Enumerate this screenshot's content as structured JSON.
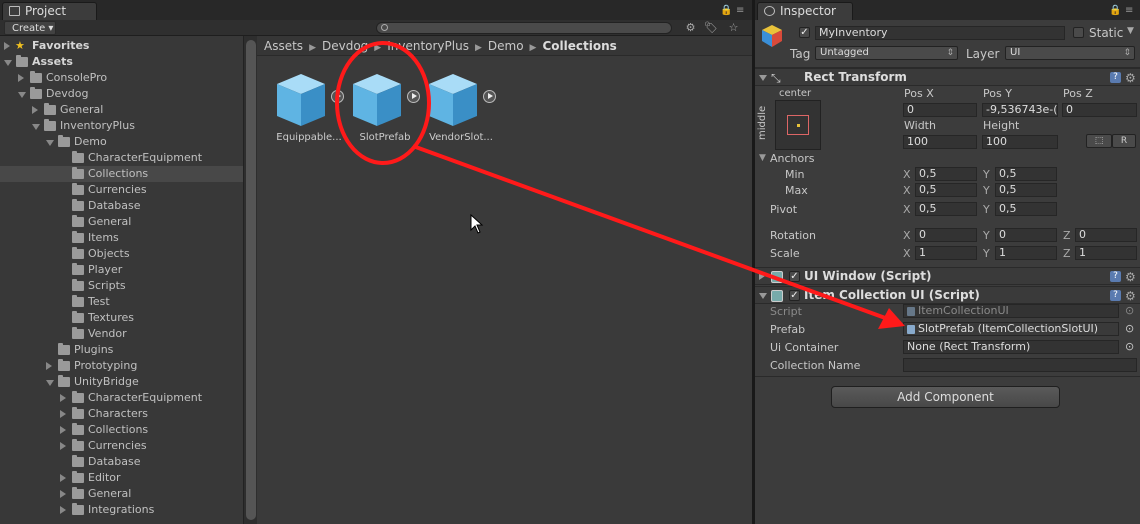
{
  "project": {
    "tab_label": "Project",
    "create_label": "Create",
    "search_placeholder": "",
    "tree": [
      {
        "label": "Favorites",
        "indent": 0,
        "arrow": "closed",
        "bold": true,
        "icon": "star"
      },
      {
        "label": "Assets",
        "indent": 0,
        "arrow": "open",
        "bold": true,
        "icon": "folder"
      },
      {
        "label": "ConsolePro",
        "indent": 1,
        "arrow": "closed",
        "icon": "folder"
      },
      {
        "label": "Devdog",
        "indent": 1,
        "arrow": "open",
        "icon": "folder"
      },
      {
        "label": "General",
        "indent": 2,
        "arrow": "closed",
        "icon": "folder"
      },
      {
        "label": "InventoryPlus",
        "indent": 2,
        "arrow": "open",
        "icon": "folder"
      },
      {
        "label": "Demo",
        "indent": 3,
        "arrow": "open",
        "icon": "folder"
      },
      {
        "label": "CharacterEquipment",
        "indent": 4,
        "arrow": "none",
        "icon": "folder"
      },
      {
        "label": "Collections",
        "indent": 4,
        "arrow": "none",
        "icon": "folder",
        "selected": true
      },
      {
        "label": "Currencies",
        "indent": 4,
        "arrow": "none",
        "icon": "folder"
      },
      {
        "label": "Database",
        "indent": 4,
        "arrow": "none",
        "icon": "folder"
      },
      {
        "label": "General",
        "indent": 4,
        "arrow": "none",
        "icon": "folder"
      },
      {
        "label": "Items",
        "indent": 4,
        "arrow": "none",
        "icon": "folder"
      },
      {
        "label": "Objects",
        "indent": 4,
        "arrow": "none",
        "icon": "folder"
      },
      {
        "label": "Player",
        "indent": 4,
        "arrow": "none",
        "icon": "folder"
      },
      {
        "label": "Scripts",
        "indent": 4,
        "arrow": "none",
        "icon": "folder"
      },
      {
        "label": "Test",
        "indent": 4,
        "arrow": "none",
        "icon": "folder"
      },
      {
        "label": "Textures",
        "indent": 4,
        "arrow": "none",
        "icon": "folder"
      },
      {
        "label": "Vendor",
        "indent": 4,
        "arrow": "none",
        "icon": "folder"
      },
      {
        "label": "Plugins",
        "indent": 3,
        "arrow": "none",
        "icon": "folder"
      },
      {
        "label": "Prototyping",
        "indent": 3,
        "arrow": "closed",
        "icon": "folder"
      },
      {
        "label": "UnityBridge",
        "indent": 3,
        "arrow": "open",
        "icon": "folder"
      },
      {
        "label": "CharacterEquipment",
        "indent": 4,
        "arrow": "closed",
        "icon": "folder"
      },
      {
        "label": "Characters",
        "indent": 4,
        "arrow": "closed",
        "icon": "folder"
      },
      {
        "label": "Collections",
        "indent": 4,
        "arrow": "closed",
        "icon": "folder"
      },
      {
        "label": "Currencies",
        "indent": 4,
        "arrow": "closed",
        "icon": "folder"
      },
      {
        "label": "Database",
        "indent": 4,
        "arrow": "none",
        "icon": "folder"
      },
      {
        "label": "Editor",
        "indent": 4,
        "arrow": "closed",
        "icon": "folder"
      },
      {
        "label": "General",
        "indent": 4,
        "arrow": "closed",
        "icon": "folder"
      },
      {
        "label": "Integrations",
        "indent": 4,
        "arrow": "closed",
        "icon": "folder"
      }
    ],
    "breadcrumbs": [
      "Assets",
      "Devdog",
      "InventoryPlus",
      "Demo",
      "Collections"
    ],
    "assets": [
      {
        "name": "Equippable..."
      },
      {
        "name": "SlotPrefab"
      },
      {
        "name": "VendorSlot..."
      }
    ]
  },
  "inspector": {
    "tab_label": "Inspector",
    "object_name": "MyInventory",
    "static_label": "Static",
    "tag_label": "Tag",
    "tag_value": "Untagged",
    "layer_label": "Layer",
    "layer_value": "UI",
    "rect_title": "Rect Transform",
    "anchor_h": "center",
    "anchor_v": "middle",
    "posx_label": "Pos X",
    "posy_label": "Pos Y",
    "posz_label": "Pos Z",
    "posx": "0",
    "posy": "-9,536743e-(",
    "posz": "0",
    "width_label": "Width",
    "height_label": "Height",
    "width": "100",
    "height": "100",
    "r_button": "R",
    "anchors_label": "Anchors",
    "min_label": "Min",
    "max_label": "Max",
    "min_x": "0,5",
    "min_y": "0,5",
    "max_x": "0,5",
    "max_y": "0,5",
    "pivot_label": "Pivot",
    "pivot_x": "0,5",
    "pivot_y": "0,5",
    "rotation_label": "Rotation",
    "rot_x": "0",
    "rot_y": "0",
    "rot_z": "0",
    "scale_label": "Scale",
    "scale_x": "1",
    "scale_y": "1",
    "scale_z": "1",
    "x": "X",
    "y": "Y",
    "z": "Z",
    "ui_window_title": "UI Window (Script)",
    "item_coll_title": "Item Collection UI (Script)",
    "script_label": "Script",
    "script_value": "ItemCollectionUI",
    "prefab_label": "Prefab",
    "prefab_value": "SlotPrefab (ItemCollectionSlotUI)",
    "container_label": "Ui Container",
    "container_value": "None (Rect Transform)",
    "collname_label": "Collection Name",
    "collname_value": "",
    "add_component": "Add Component"
  },
  "colors": {
    "annotation_red": "#ff1a1a",
    "cube_blue": "#5fb4e3",
    "background": "#383838"
  }
}
